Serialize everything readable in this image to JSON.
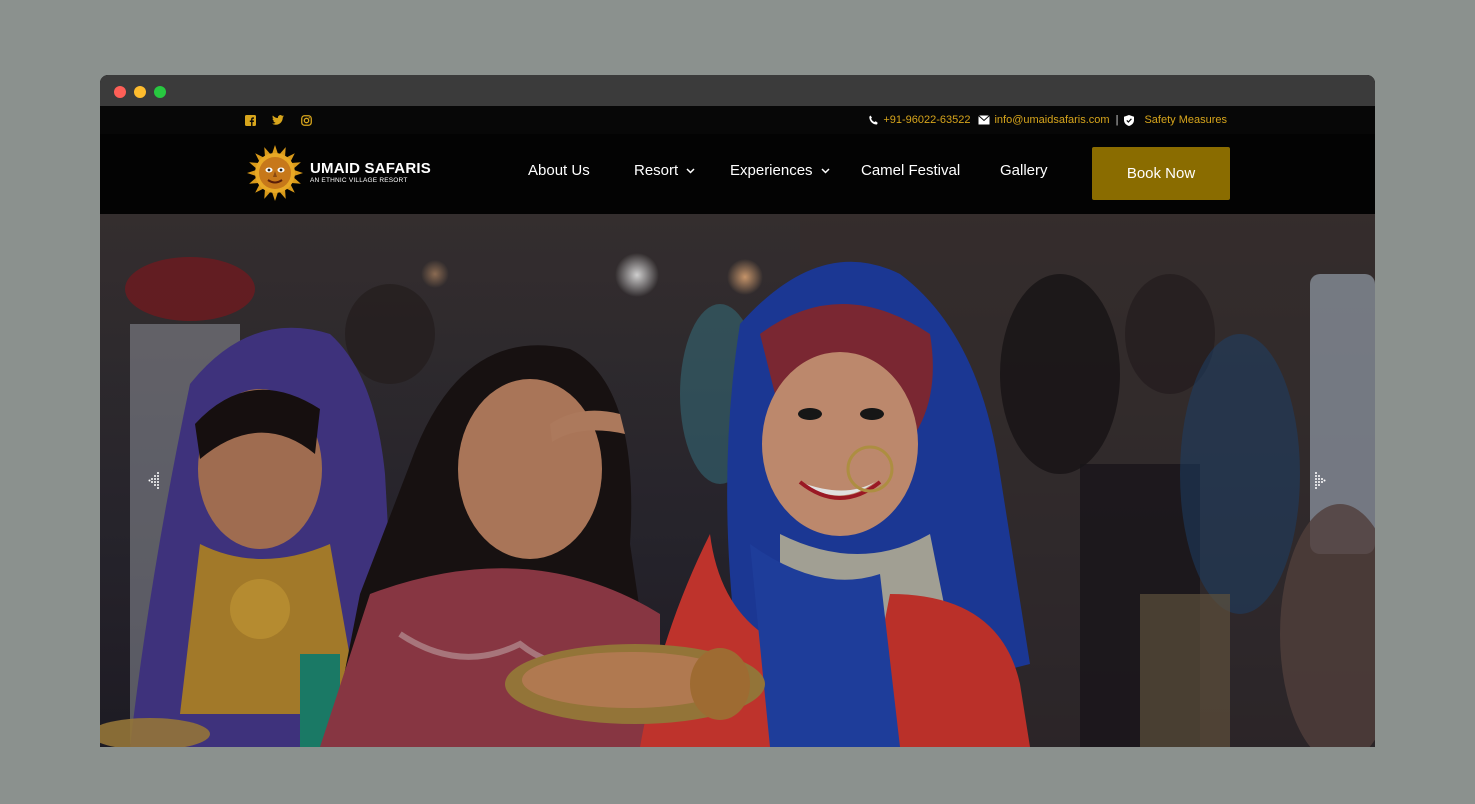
{
  "browser": {
    "window_controls": [
      "close",
      "minimize",
      "maximize"
    ]
  },
  "topbar": {
    "social": [
      "facebook-icon",
      "twitter-icon",
      "instagram-icon"
    ],
    "phone": "+91-96022-63522",
    "email": "info@umaidsafaris.com",
    "separator": "|",
    "safety": "Safety Measures"
  },
  "logo": {
    "brand": "UMAID SAFARIS",
    "tagline": "AN ETHNIC VILLAGE RESORT"
  },
  "nav": {
    "about": "About Us",
    "resort": "Resort",
    "experiences": "Experiences",
    "camel": "Camel Festival",
    "gallery": "Gallery",
    "book": "Book Now"
  },
  "colors": {
    "accent": "#d7a51c",
    "button": "#8a6c00",
    "background": "#8b918e"
  }
}
